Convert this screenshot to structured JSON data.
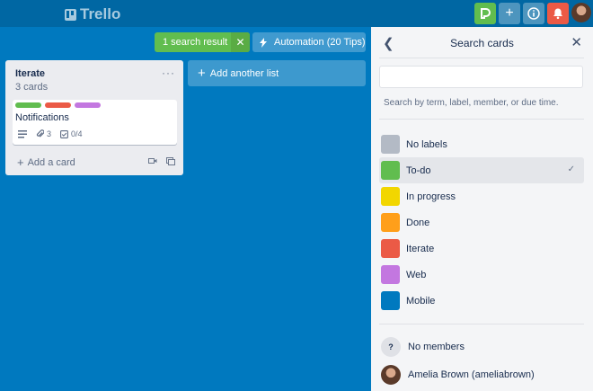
{
  "header": {
    "logo_text": "Trello",
    "buttons": [
      {
        "icon": "butler-icon"
      },
      {
        "icon": "plus-icon"
      },
      {
        "icon": "info-icon"
      },
      {
        "icon": "bell-icon"
      }
    ],
    "avatar": "user-avatar"
  },
  "board": {
    "search_result_label": "1 search result",
    "search_result_close": "✕",
    "automation_label": "Automation (20 Tips)",
    "add_list_label": "Add another list"
  },
  "list": {
    "title": "Iterate",
    "count": "3 cards",
    "menu": "···",
    "card": {
      "labels": [
        "#61bd4f",
        "#eb5a46",
        "#c377e0"
      ],
      "title": "Notifications",
      "attachments": "3",
      "checklist": "0/4"
    },
    "add_card_label": "Add a card"
  },
  "panel": {
    "title": "Search cards",
    "search_value": "",
    "search_placeholder": "",
    "hint": "Search by term, label, member, or due time.",
    "labels": [
      {
        "name": "No labels",
        "color": "#b3bac5",
        "selected": false
      },
      {
        "name": "To-do",
        "color": "#61bd4f",
        "selected": true
      },
      {
        "name": "In progress",
        "color": "#f2d600",
        "selected": false
      },
      {
        "name": "Done",
        "color": "#ff9f1a",
        "selected": false
      },
      {
        "name": "Iterate",
        "color": "#eb5a46",
        "selected": false
      },
      {
        "name": "Web",
        "color": "#c377e0",
        "selected": false
      },
      {
        "name": "Mobile",
        "color": "#0079bf",
        "selected": false
      }
    ],
    "no_members_label": "No members",
    "no_members_glyph": "?",
    "member_name": "Amelia Brown (ameliabrown)"
  }
}
